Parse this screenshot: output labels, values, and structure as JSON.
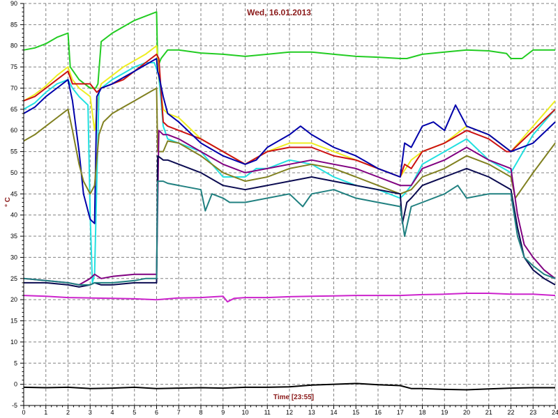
{
  "chart_data": {
    "type": "line",
    "title": "Wed, 16.01.2013",
    "xlabel": "Time [23:55]",
    "ylabel": "° C",
    "xlim": [
      0,
      24
    ],
    "ylim": [
      -5,
      90
    ],
    "x_ticks": [
      0,
      1,
      2,
      3,
      4,
      5,
      6,
      7,
      8,
      9,
      10,
      11,
      12,
      13,
      14,
      15,
      16,
      17,
      18,
      19,
      20,
      21,
      22,
      23,
      24
    ],
    "y_ticks": [
      -5,
      0,
      5,
      10,
      15,
      20,
      25,
      30,
      35,
      40,
      45,
      50,
      55,
      60,
      65,
      70,
      75,
      80,
      85,
      90
    ],
    "grid": true,
    "series": [
      {
        "color": "#22cc22",
        "x": [
          0,
          0.5,
          1,
          1.5,
          2,
          2.1,
          2.5,
          3,
          3.25,
          3.35,
          3.5,
          4,
          4.5,
          5,
          5.5,
          6,
          6.05,
          6.2,
          6.5,
          7,
          8,
          9,
          10,
          11,
          12,
          13,
          14,
          15,
          16,
          17,
          17.3,
          18,
          19,
          20,
          21,
          21.8,
          22,
          22.5,
          23,
          24
        ],
        "y": [
          79,
          79.5,
          80.5,
          82,
          83,
          75,
          72,
          70,
          70,
          71,
          81,
          83,
          84.5,
          86,
          87,
          88,
          75,
          77,
          79,
          79,
          78.3,
          78,
          77.5,
          78,
          78.5,
          78.5,
          78,
          77.5,
          77.3,
          77,
          77,
          78,
          78.5,
          79,
          78.8,
          78.2,
          77,
          77,
          79,
          79
        ]
      },
      {
        "color": "#eeee22",
        "x": [
          0,
          0.5,
          1,
          1.5,
          2,
          2.2,
          2.5,
          3,
          3.2,
          3.4,
          3.5,
          4,
          4.5,
          5,
          5.5,
          6,
          6.1,
          6.3,
          6.5,
          7,
          8,
          9,
          10,
          11,
          12,
          13,
          14,
          15,
          16,
          16.5,
          17,
          17.5,
          18,
          19,
          20,
          21,
          22,
          23,
          24
        ],
        "y": [
          67,
          68.5,
          70.5,
          73,
          75,
          72,
          70,
          68,
          60,
          69,
          71,
          73,
          75,
          76.5,
          78,
          80,
          72,
          65,
          64,
          63,
          58,
          55,
          52,
          55,
          57,
          57,
          55,
          53,
          51,
          50,
          49,
          53,
          55,
          57,
          61,
          59,
          55,
          61,
          67
        ]
      },
      {
        "color": "#22e0e0",
        "x": [
          0,
          0.5,
          1,
          1.5,
          2,
          2.2,
          2.5,
          2.9,
          3.0,
          3.1,
          3.2,
          3.4,
          3.5,
          4,
          4.5,
          5,
          5.5,
          5.9,
          6.1,
          6.3,
          6.5,
          7,
          7.5,
          8,
          9,
          10,
          10.5,
          11,
          12,
          13,
          14,
          15,
          16,
          17,
          17.2,
          17.5,
          18,
          19,
          20,
          21,
          22,
          23,
          24
        ],
        "y": [
          65,
          66.5,
          69,
          71,
          72,
          70,
          68,
          66,
          40,
          24,
          26,
          69,
          70,
          72,
          73.5,
          75,
          76,
          76,
          73,
          61,
          58,
          57,
          56,
          55,
          49,
          49,
          51,
          51,
          53,
          52,
          49,
          47,
          46,
          44,
          45,
          47,
          52,
          55,
          58,
          53,
          50,
          59,
          65
        ]
      },
      {
        "color": "#cc1111",
        "x": [
          0,
          0.5,
          1,
          1.5,
          2,
          2.2,
          2.5,
          3,
          3.3,
          3.5,
          4,
          4.5,
          5,
          5.5,
          6,
          6.1,
          6.3,
          6.5,
          7,
          8,
          9,
          10,
          11,
          12,
          13,
          14,
          15,
          16,
          17,
          17.2,
          17.5,
          18,
          19,
          20,
          21,
          21.8,
          22,
          23,
          24
        ],
        "y": [
          67,
          68,
          70,
          72,
          74,
          71,
          71,
          71,
          69,
          70,
          71,
          72,
          74,
          76,
          78,
          77,
          62,
          61,
          60,
          58,
          55,
          52,
          55,
          56,
          56,
          54,
          53,
          51,
          49,
          52,
          51,
          55,
          57,
          60,
          58,
          55,
          55,
          60,
          65
        ]
      },
      {
        "color": "#0000aa",
        "x": [
          0,
          0.5,
          1,
          1.5,
          2,
          2.2,
          2.5,
          2.7,
          3,
          3.2,
          3.3,
          3.5,
          4,
          4.5,
          5,
          5.5,
          6,
          6.05,
          6.1,
          6.3,
          6.5,
          7,
          8,
          9,
          10,
          10.5,
          11,
          12,
          12.5,
          13,
          14,
          15,
          16,
          16.5,
          17,
          17.2,
          17.5,
          18,
          18.5,
          19,
          19.5,
          20,
          21,
          22,
          23,
          24
        ],
        "y": [
          64,
          65.5,
          68,
          70,
          72,
          67,
          55,
          45,
          39,
          38,
          68,
          70,
          71,
          72.5,
          74,
          75.5,
          77,
          74,
          73,
          68,
          64,
          62,
          57,
          54,
          52,
          53,
          56,
          59,
          61,
          59,
          56,
          54,
          51,
          50,
          49,
          57,
          56,
          61,
          62,
          60,
          66,
          61,
          59,
          55,
          57,
          62
        ]
      },
      {
        "color": "#808020",
        "x": [
          0,
          0.5,
          1,
          1.5,
          2,
          2.2,
          2.5,
          2.7,
          3,
          3.2,
          3.4,
          3.6,
          4,
          4.5,
          5,
          5.5,
          6,
          6.05,
          6.3,
          6.5,
          7,
          8,
          9,
          10,
          11,
          12,
          13,
          14,
          15,
          16,
          17,
          17.5,
          18,
          19,
          20,
          21,
          22,
          22.2,
          23,
          24
        ],
        "y": [
          57.5,
          59,
          61,
          63,
          65,
          60,
          52,
          48,
          45,
          47,
          59,
          62,
          64,
          65.5,
          67,
          68.5,
          70,
          55,
          55,
          57.5,
          57,
          54,
          50,
          48,
          49,
          51,
          52,
          51,
          49,
          47,
          45,
          46,
          49,
          51,
          54,
          52,
          49,
          44,
          50,
          57
        ]
      },
      {
        "color": "#800080",
        "x": [
          0,
          1,
          2,
          2.5,
          3,
          3.2,
          3.5,
          4,
          5,
          5.5,
          6,
          6.1,
          6.3,
          6.5,
          7,
          8,
          9,
          10,
          11,
          12,
          13,
          14,
          15,
          16,
          17,
          17.5,
          18,
          19,
          20,
          21,
          22,
          22.3,
          22.6,
          23,
          23.5,
          24
        ],
        "y": [
          25,
          24.5,
          24,
          23.5,
          25,
          26,
          25,
          25.5,
          26,
          26,
          26,
          60,
          59,
          59,
          58,
          55,
          52,
          50,
          51,
          52,
          53,
          52,
          51,
          49,
          47,
          47,
          51,
          53,
          56,
          53,
          51,
          40,
          33,
          30,
          27,
          25
        ]
      },
      {
        "color": "#0a0a50",
        "x": [
          0,
          1,
          2,
          2.5,
          3,
          3.2,
          3.5,
          4,
          5,
          5.5,
          6,
          6.05,
          6.3,
          6.5,
          7,
          8,
          9,
          10,
          11,
          12,
          13,
          14,
          15,
          16,
          17,
          17.1,
          17.3,
          17.5,
          18,
          19,
          20,
          21,
          22,
          22.3,
          22.6,
          23,
          23.5,
          24
        ],
        "y": [
          24,
          24,
          23.5,
          23,
          23.5,
          24,
          23.5,
          23.5,
          24,
          24,
          24,
          54,
          53,
          53,
          52,
          50,
          47,
          46,
          47,
          48,
          49,
          48,
          47,
          46,
          45,
          38,
          43,
          44,
          47,
          49,
          51,
          49,
          46,
          37,
          30,
          27,
          25,
          23.5
        ]
      },
      {
        "color": "#208080",
        "x": [
          0,
          1,
          2,
          2.5,
          3,
          3.2,
          3.5,
          4,
          5,
          5.5,
          6,
          6.05,
          6.3,
          6.5,
          7,
          8,
          8.2,
          8.5,
          9,
          9.3,
          10,
          11,
          12,
          12.6,
          13,
          14,
          15,
          16,
          17,
          17.2,
          17.5,
          18,
          19,
          19.6,
          20,
          21,
          22,
          22.3,
          22.6,
          23,
          23.5,
          24
        ],
        "y": [
          25,
          24.5,
          24,
          23.5,
          23.5,
          24,
          24,
          24,
          24.5,
          25,
          25,
          48,
          48,
          47.5,
          47,
          46,
          41,
          45,
          44,
          43,
          43,
          44,
          45,
          42,
          45,
          46,
          44,
          43,
          42,
          35,
          42,
          43,
          45,
          47,
          44,
          45,
          45,
          35,
          30,
          28,
          26,
          25
        ]
      },
      {
        "color": "#cc22cc",
        "x": [
          0,
          1,
          2,
          3,
          4,
          5,
          6,
          7,
          8,
          9,
          9.2,
          9.5,
          10,
          11,
          12,
          13,
          14,
          15,
          16,
          17,
          18,
          19,
          20,
          21,
          22,
          23,
          24
        ],
        "y": [
          21,
          20.8,
          20.5,
          20.4,
          20.3,
          20.2,
          20,
          20.4,
          20.5,
          20.8,
          19.5,
          20.3,
          20.5,
          20.5,
          20.7,
          20.8,
          20.9,
          21,
          21,
          21,
          21.2,
          21.3,
          21.5,
          21.5,
          21.3,
          21.3,
          21
        ]
      },
      {
        "color": "#000000",
        "x": [
          0,
          1,
          2,
          3,
          4,
          5,
          6,
          7,
          8,
          9,
          10,
          11,
          12,
          13,
          14,
          15,
          16,
          17,
          17.5,
          18,
          19,
          20,
          21,
          22,
          23,
          24
        ],
        "y": [
          -0.7,
          -0.8,
          -0.7,
          -1,
          -0.9,
          -0.7,
          -1,
          -0.9,
          -0.8,
          -0.9,
          -0.7,
          -0.7,
          -0.6,
          -0.2,
          0,
          0.2,
          -0.1,
          -0.3,
          -1,
          -1,
          -1.2,
          -1.3,
          -1.1,
          -0.9,
          -0.8,
          -0.8
        ]
      }
    ]
  }
}
